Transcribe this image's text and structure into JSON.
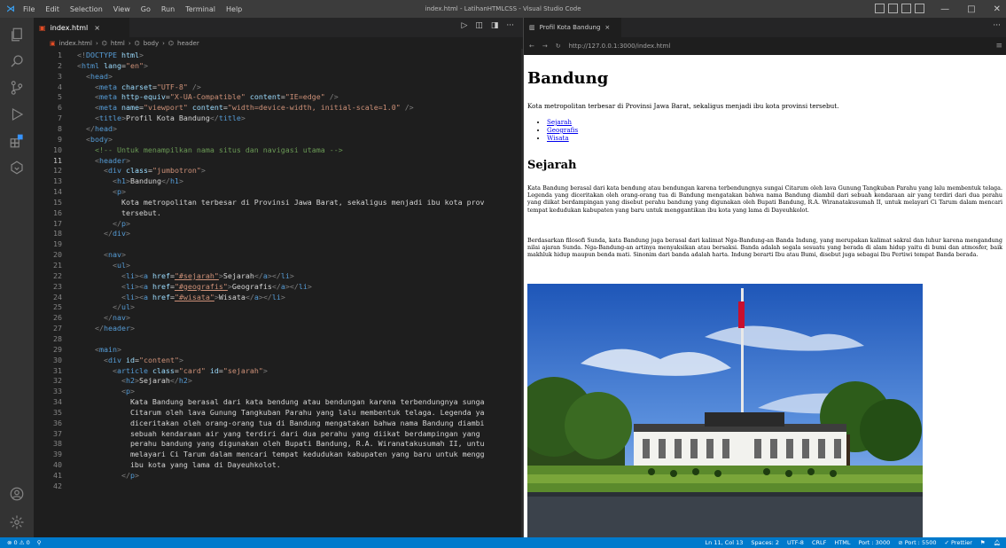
{
  "window": {
    "title": "index.html - LatihanHTMLCSS - Visual Studio Code",
    "menu": [
      "File",
      "Edit",
      "Selection",
      "View",
      "Go",
      "Run",
      "Terminal",
      "Help"
    ],
    "controls": [
      "—",
      "□",
      "✕"
    ]
  },
  "activity_bar": [
    "explorer-icon",
    "search-icon",
    "source-control-icon",
    "run-debug-icon",
    "extensions-icon",
    "remote-icon",
    "accounts-icon",
    "settings-gear-icon"
  ],
  "editor": {
    "tab_label": "index.html",
    "tab_close": "×",
    "breadcrumb": [
      "index.html",
      "html",
      "body",
      "header"
    ],
    "code_lines": [
      {
        "n": "1",
        "t": "<!DOCTYPE html>"
      },
      {
        "n": "2",
        "t": "<html lang=\"en\">"
      },
      {
        "n": "3",
        "t": "  <head>"
      },
      {
        "n": "4",
        "t": "    <meta charset=\"UTF-8\" />"
      },
      {
        "n": "5",
        "t": "    <meta http-equiv=\"X-UA-Compatible\" content=\"IE=edge\" />"
      },
      {
        "n": "6",
        "t": "    <meta name=\"viewport\" content=\"width=device-width, initial-scale=1.0\" />"
      },
      {
        "n": "7",
        "t": "    <title>Profil Kota Bandung</title>"
      },
      {
        "n": "8",
        "t": "  </head>"
      },
      {
        "n": "9",
        "t": "  <body>"
      },
      {
        "n": "10",
        "t": "    <!-- Untuk menampilkan nama situs dan navigasi utama -->"
      },
      {
        "n": "11",
        "t": "    <header>"
      },
      {
        "n": "12",
        "t": "      <div class=\"jumbotron\">"
      },
      {
        "n": "13",
        "t": "        <h1>Bandung</h1>"
      },
      {
        "n": "14",
        "t": "        <p>"
      },
      {
        "n": "15",
        "t": "          Kota metropolitan terbesar di Provinsi Jawa Barat, sekaligus menjadi ibu kota prov"
      },
      {
        "n": "16",
        "t": "          tersebut."
      },
      {
        "n": "17",
        "t": "        </p>"
      },
      {
        "n": "18",
        "t": "      </div>"
      },
      {
        "n": "19",
        "t": ""
      },
      {
        "n": "20",
        "t": "      <nav>"
      },
      {
        "n": "21",
        "t": "        <ul>"
      },
      {
        "n": "22",
        "t": "          <li><a href=\"#sejarah\">Sejarah</a></li>"
      },
      {
        "n": "23",
        "t": "          <li><a href=\"#geografis\">Geografis</a></li>"
      },
      {
        "n": "24",
        "t": "          <li><a href=\"#wisata\">Wisata</a></li>"
      },
      {
        "n": "25",
        "t": "        </ul>"
      },
      {
        "n": "26",
        "t": "      </nav>"
      },
      {
        "n": "27",
        "t": "    </header>"
      },
      {
        "n": "28",
        "t": ""
      },
      {
        "n": "29",
        "t": "    <main>"
      },
      {
        "n": "30",
        "t": "      <div id=\"content\">"
      },
      {
        "n": "31",
        "t": "        <article class=\"card\" id=\"sejarah\">"
      },
      {
        "n": "32",
        "t": "          <h2>Sejarah</h2>"
      },
      {
        "n": "33",
        "t": "          <p>"
      },
      {
        "n": "34",
        "t": "            Kata Bandung berasal dari kata bendung atau bendungan karena terbendungnya sunga"
      },
      {
        "n": "35",
        "t": "            Citarum oleh lava Gunung Tangkuban Parahu yang lalu membentuk telaga. Legenda ya"
      },
      {
        "n": "36",
        "t": "            diceritakan oleh orang-orang tua di Bandung mengatakan bahwa nama Bandung diambi"
      },
      {
        "n": "37",
        "t": "            sebuah kendaraan air yang terdiri dari dua perahu yang diikat berdampingan yang"
      },
      {
        "n": "38",
        "t": "            perahu bandung yang digunakan oleh Bupati Bandung, R.A. Wiranatakusumah II, untu"
      },
      {
        "n": "39",
        "t": "            melayari Ci Tarum dalam mencari tempat kedudukan kabupaten yang baru untuk mengg"
      },
      {
        "n": "40",
        "t": "            ibu kota yang lama di Dayeuhkolot."
      },
      {
        "n": "41",
        "t": "          </p>"
      },
      {
        "n": "42",
        "t": ""
      }
    ]
  },
  "preview": {
    "tab_label": "Profil Kota Bandung",
    "tab_close": "×",
    "url": "http://127.0.0.1:3000/index.html",
    "h1": "Bandung",
    "intro": "Kota metropolitan terbesar di Provinsi Jawa Barat, sekaligus menjadi ibu kota provinsi tersebut.",
    "nav": [
      "Sejarah",
      "Geografis",
      "Wisata"
    ],
    "h2": "Sejarah",
    "para1": "Kata Bandung berasal dari kata bendung atau bendungan karena terbendungnya sungai Citarum oleh lava Gunung Tangkuban Parahu yang lalu membentuk telaga. Legenda yang diceritakan oleh orang-orang tua di Bandung mengatakan bahwa nama Bandung diambil dari sebuah kendaraan air yang terdiri dari dua perahu yang diikat berdampingan yang disebut perahu bandung yang digunakan oleh Bupati Bandung, R.A. Wiranatakusumah II, untuk melayari Ci Tarum dalam mencari tempat kedudukan kabupaten yang baru untuk menggantikan ibu kota yang lama di Dayeuhkolot.",
    "para2": "Berdasarkan filosofi Sunda, kata Bandung juga berasal dari kalimat Nga-Bandung-an Banda Indung, yang merupakan kalimat sakral dan luhur karena mengandung nilai ajaran Sunda. Nga-Bandung-an artinya menyaksikan atau bersaksi. Banda adalah segala sesuatu yang berada di alam hidup yaitu di bumi dan atmosfer, baik makhluk hidup maupun benda mati. Sinonim dari banda adalah harta. Indung berarti Ibu atau Bumi, disebut juga sebagai Ibu Pertiwi tempat Banda berada."
  },
  "status_bar": {
    "left": [
      "⊗ 0 ⚠ 0",
      "⚲"
    ],
    "right": [
      "Ln 11, Col 13",
      "Spaces: 2",
      "UTF-8",
      "CRLF",
      "HTML",
      "Port : 3000",
      "⊘ Port : 5500",
      "✓ Prettier"
    ]
  },
  "colors": {
    "accent": "#007acc",
    "editor_bg": "#1e1e1e",
    "activity_bg": "#333333",
    "titlebar_bg": "#3c3c3c",
    "tag": "#569cd6",
    "attr": "#9cdcfe",
    "string": "#ce9178",
    "comment": "#6a9955"
  }
}
